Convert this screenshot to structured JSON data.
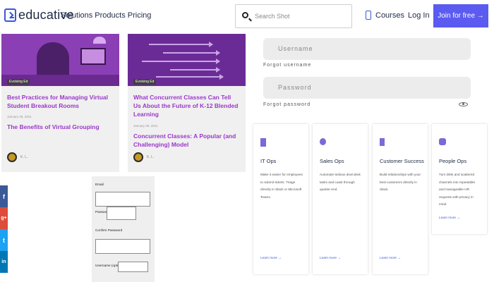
{
  "header": {
    "logo_text": "educative",
    "nav_text": "Solutions Products Pricing",
    "search_placeholder": "Search Shot",
    "courses": "Courses",
    "login": "Log In",
    "join": "Join for free →"
  },
  "blog": [
    {
      "tag": "Evolving Ed",
      "title": "Best Practices for Managing Virtual Student Breakout Rooms",
      "date": "January 28, 2021",
      "subtitle": "The Benefits of Virtual Grouping",
      "author": "K. L."
    },
    {
      "tag": "Evolving Ed",
      "title": "What Concurrent Classes Can Tell Us About the Future of K-12 Blended Learning",
      "date": "January 28, 2021",
      "subtitle": "Concurrent Classes: A Popular (and Challenging) Model",
      "author": "K. L."
    }
  ],
  "login_form": {
    "username_placeholder": "Username",
    "forgot_username": "Forgot username",
    "password_placeholder": "Password",
    "forgot_password": "Forgot password"
  },
  "features": [
    {
      "title": "IT Ops",
      "desc": "Make it easier for employees to submit tickets. Triage directly in Slack or Microsoft Teams.",
      "link": "Learn more →",
      "icon_color": "#7a6ad8"
    },
    {
      "title": "Sales Ops",
      "desc": "Automate tedious deal desk tasks and coast through quarter-end.",
      "link": "Learn more →",
      "icon_color": "#7a6ad8"
    },
    {
      "title": "Customer Success",
      "desc": "Build relationships with your best customers directly in Slack.",
      "link": "Learn more →",
      "icon_color": "#7a6ad8"
    },
    {
      "title": "People Ops",
      "desc": "Turn DMs and scattered channels into repeatable and manageable HR requests with privacy in mind.",
      "link": "Learn more →",
      "icon_color": "#7a6ad8"
    }
  ],
  "signup_form": {
    "email_label": "Email",
    "password_label": "Password",
    "confirm_label": "Confirm Password",
    "username_label": "Username (optional)"
  },
  "social": [
    {
      "icon": "f",
      "name": "facebook-icon",
      "color": "#3b5998"
    },
    {
      "icon": "g+",
      "name": "google-plus-icon",
      "color": "#dd4b39"
    },
    {
      "icon": "t",
      "name": "twitter-icon",
      "color": "#1da1f2"
    },
    {
      "icon": "in",
      "name": "linkedin-icon",
      "color": "#0077b5"
    }
  ]
}
